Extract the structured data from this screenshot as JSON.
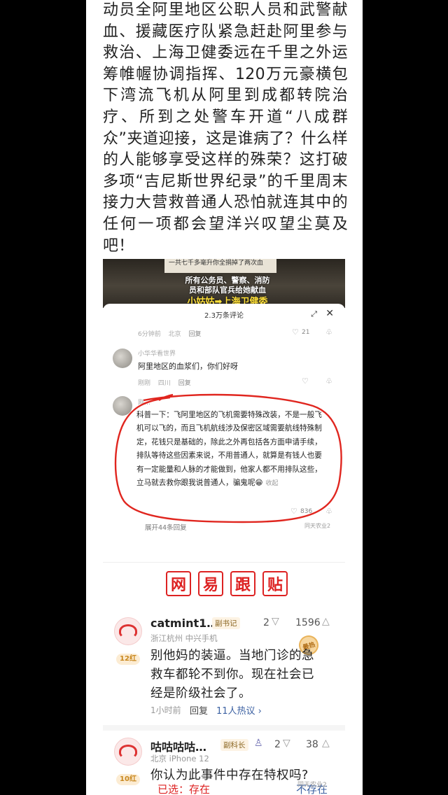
{
  "article": {
    "paragraph": "动员全阿里地区公职人员和武警献血、援藏医疗队紧急赶赴阿里参与救治、上海卫健委远在千里之外运筹帷幄协调指挥、120万元豪横包下湾流飞机从阿里到成都转院治疗、所到之处警车开道“八成群众”夹道迎接，这是谁病了？什么样的人能够享受这样的殊荣？这打破多项“吉尼斯世界纪录”的千里周末接力大营救普通人恐怕就连其中的任何一项都会望洋兴叹望尘莫及吧！"
  },
  "video": {
    "caption_top": "一共七千多毫升你全捐掉了两次血",
    "caption_line1": "所有公务员、警察、消防",
    "caption_line2": "员和部队官兵给她献血",
    "caption_line3": "小姑姑➡上海卫健委"
  },
  "comments_sheet": {
    "count_title": "2.3万条评论",
    "first_meta": {
      "time": "6分钟前",
      "location": "北京",
      "reply": "回复",
      "likes": "21"
    },
    "comment1": {
      "user": "小华华看世界",
      "text": "阿里地区的血浆们，你们好呀",
      "time": "刚刚",
      "location": "四川",
      "reply": "回复"
    },
    "comment2": {
      "user": "刚…",
      "text": "科普一下：飞阿里地区的飞机需要特殊改装，不是一般飞机可以飞的，而且飞机航线涉及保密区域需要航线特殊制定，花钱只是基础的，除此之外再包括各方面申请手续，排队等待这些因素来说，不用普通人，就算是有钱人也要有一定能量和人脉的才能做到，他家人都不用排队这些，立马就去救你跟我说普通人，骗鬼呢😁",
      "fold": "收起",
      "likes": "836",
      "expand": "展开44条回复"
    },
    "watermark": "同天农业2"
  },
  "netease": {
    "title_chars": [
      "网",
      "易",
      "跟",
      "贴"
    ],
    "reply1": {
      "name": "catmint1…",
      "badge": "副书记",
      "level": "12红",
      "location": "浙江杭州  中兴手机",
      "dislikes": "2",
      "likes": "1596",
      "stamp": "最热",
      "text": "别他妈的装逼。当地门诊的急救车都轮不到你。现在社会已经是阶级社会了。",
      "time": "1小时前",
      "reply": "回复",
      "hot": "11人热议 ›"
    },
    "reply2": {
      "name": "咕咕咕咕…",
      "badge": "副科长",
      "level": "10红",
      "location": "北京  iPhone 12",
      "dislikes": "2",
      "likes": "38",
      "text": "你认为此事件中存在特权吗?",
      "poll_selected": "已选：存在",
      "poll_other": "不存在"
    },
    "watermark": "同天农业2"
  }
}
